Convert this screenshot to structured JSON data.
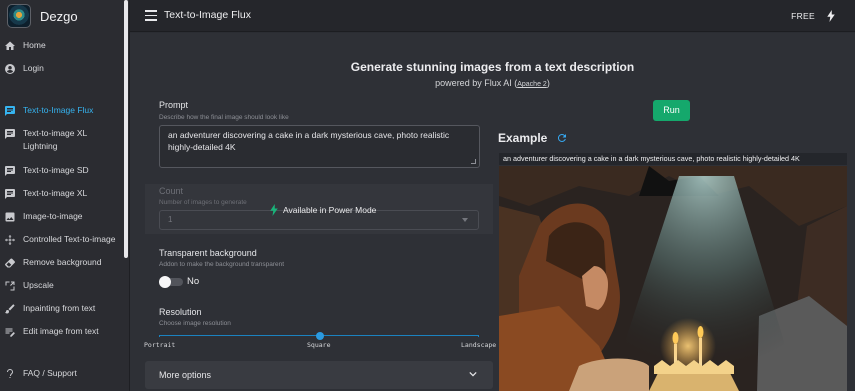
{
  "app": {
    "name": "Dezgo"
  },
  "sidebar": {
    "items": [
      {
        "label": "Home",
        "icon": "home-icon",
        "active": false
      },
      {
        "label": "Login",
        "icon": "account-icon",
        "active": false
      },
      {
        "label": "Text-to-Image Flux",
        "icon": "text-bubble-icon",
        "active": true
      },
      {
        "label": "Text-to-image XL Lightning",
        "icon": "text-bubble-icon",
        "active": false
      },
      {
        "label": "Text-to-image SD",
        "icon": "text-bubble-icon",
        "active": false
      },
      {
        "label": "Text-to-image XL",
        "icon": "text-bubble-icon",
        "active": false
      },
      {
        "label": "Image-to-image",
        "icon": "image-icon",
        "active": false
      },
      {
        "label": "Controlled Text-to-image",
        "icon": "move-icon",
        "active": false
      },
      {
        "label": "Remove background",
        "icon": "eraser-icon",
        "active": false
      },
      {
        "label": "Upscale",
        "icon": "upscale-icon",
        "active": false
      },
      {
        "label": "Inpainting from text",
        "icon": "brush-icon",
        "active": false
      },
      {
        "label": "Edit image from text",
        "icon": "edit-text-icon",
        "active": false
      },
      {
        "label": "FAQ / Support",
        "icon": "help-icon",
        "active": false
      }
    ]
  },
  "header": {
    "title": "Text-to-Image Flux",
    "plan_label": "FREE"
  },
  "main": {
    "headline": "Generate stunning images from a text description",
    "subline_prefix": "powered by Flux AI (",
    "license_link": "Apache 2",
    "subline_suffix": ")"
  },
  "form": {
    "prompt": {
      "label": "Prompt",
      "help": "Describe how the final image should look like",
      "value": "an adventurer discovering a cake in a dark mysterious cave, photo realistic highly-detailed 4K"
    },
    "count": {
      "label": "Count",
      "help": "Number of images to generate",
      "value": "1",
      "locked_note": "Available in Power Mode"
    },
    "transparent": {
      "label": "Transparent background",
      "help": "Addon to make the background transparent",
      "value_text": "No",
      "enabled": false
    },
    "resolution": {
      "label": "Resolution",
      "help": "Choose image resolution",
      "marks": [
        "Portrait",
        "Square",
        "Landscape"
      ],
      "selected": "Square"
    },
    "more_options_label": "More options"
  },
  "run_label": "Run",
  "example": {
    "title": "Example",
    "caption": "an adventurer discovering a cake in a dark mysterious cave, photo realistic highly-detailed 4K"
  },
  "colors": {
    "accent": "#36b4f0",
    "run": "#15a86c",
    "slider": "#2b9ae0"
  }
}
